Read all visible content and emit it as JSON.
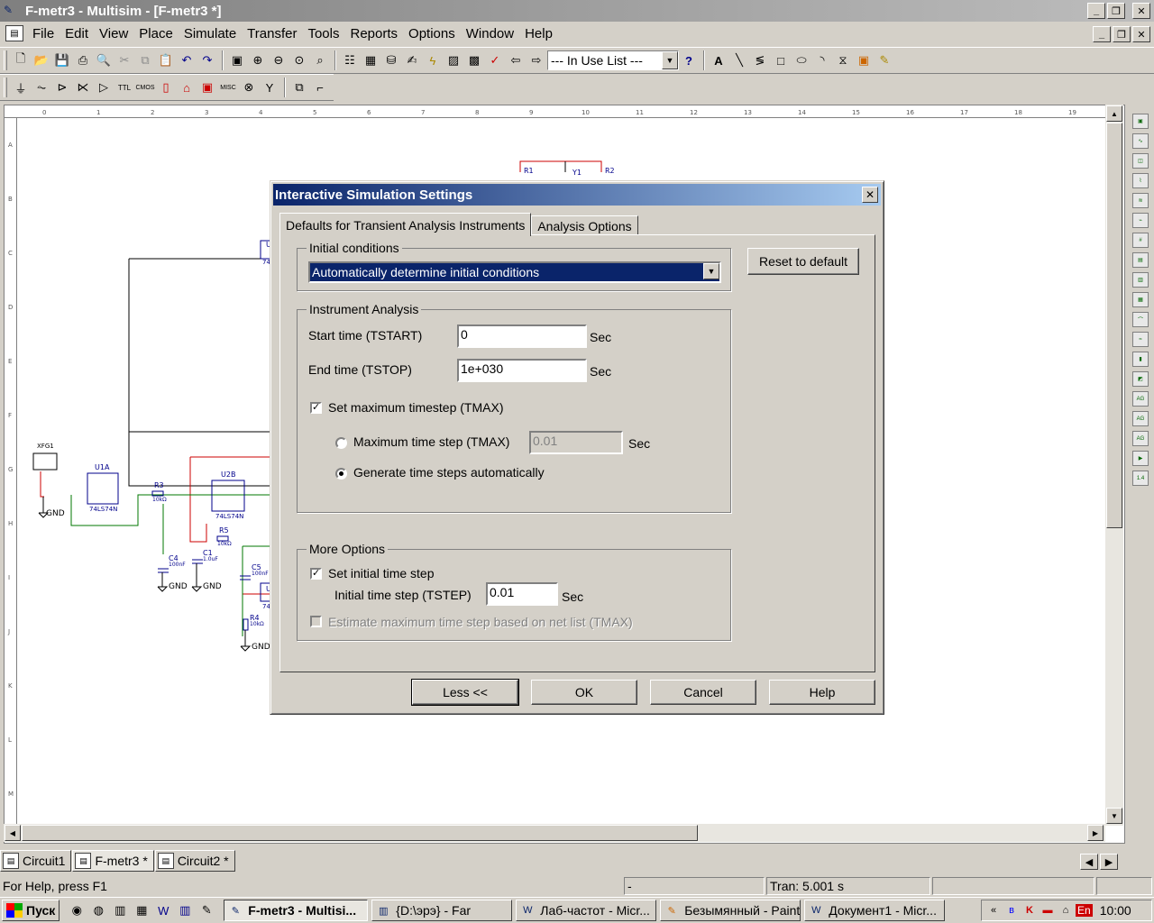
{
  "window": {
    "title": "F-metr3 - Multisim - [F-metr3 *]"
  },
  "menu": {
    "items": [
      "File",
      "Edit",
      "View",
      "Place",
      "Simulate",
      "Transfer",
      "Tools",
      "Reports",
      "Options",
      "Window",
      "Help"
    ]
  },
  "toolbar": {
    "in_use_list": "--- In Use List ---",
    "help_glyph": "?"
  },
  "schematic": {
    "labels": {
      "xfg1": "XFG1",
      "u1a": "U1A",
      "u1a_part": "74LS74N",
      "u2b": "U2B",
      "u2b_part": "74LS74N",
      "r3": "R3",
      "r3_val": "10kΩ",
      "r5": "R5",
      "r5_val": "10kΩ",
      "r4": "R4",
      "r4_val": "10kΩ",
      "c4": "C4",
      "c4_val": "100nF",
      "c1": "C1",
      "c1_val": "1.0uF",
      "c5": "C5",
      "c5_val": "100nF",
      "gnd": "GND",
      "u_top": "U",
      "u_top_part": "74L",
      "r1": "R1",
      "r2": "R2",
      "y1": "Y1"
    }
  },
  "dialog": {
    "title": "Interactive Simulation Settings",
    "tabs": [
      "Defaults for Transient Analysis Instruments",
      "Analysis Options"
    ],
    "initial_conditions": {
      "group_title": "Initial conditions",
      "selected": "Automatically determine initial conditions"
    },
    "reset_label": "Reset to default",
    "instrument_analysis": {
      "group_title": "Instrument Analysis",
      "start_label": "Start time (TSTART)",
      "start_value": "0",
      "end_label": "End time (TSTOP)",
      "end_value": "1e+030",
      "unit": "Sec",
      "set_tmax_label": "Set maximum timestep (TMAX)",
      "max_step_label": "Maximum time step (TMAX)",
      "max_step_value": "0.01",
      "auto_label": "Generate time steps automatically"
    },
    "more_options": {
      "group_title": "More Options",
      "set_initial_label": "Set initial time step",
      "tstep_label": "Initial time step (TSTEP)",
      "tstep_value": "0.01",
      "estimate_label": "Estimate maximum time step based on net list (TMAX)"
    },
    "buttons": {
      "less": "Less <<",
      "ok": "OK",
      "cancel": "Cancel",
      "help": "Help"
    }
  },
  "sheets": [
    "Circuit1",
    "F-metr3 *",
    "Circuit2 *"
  ],
  "status": {
    "help": "For Help, press F1",
    "dash": "-",
    "tran": "Tran: 5.001 s"
  },
  "taskbar": {
    "start": "Пуск",
    "tasks": [
      "F-metr3 - Multisi...",
      "{D:\\эрэ} - Far",
      "Лаб-частот - Micr...",
      "Безымянный - Paint",
      "Документ1 - Micr..."
    ],
    "lang": "En",
    "clock": "10:00",
    "tray_chevron": "«"
  },
  "colors": {
    "active_title": "#0a246a",
    "wire_red": "#cc0000",
    "wire_green": "#007700",
    "component_blue": "#00008b"
  }
}
